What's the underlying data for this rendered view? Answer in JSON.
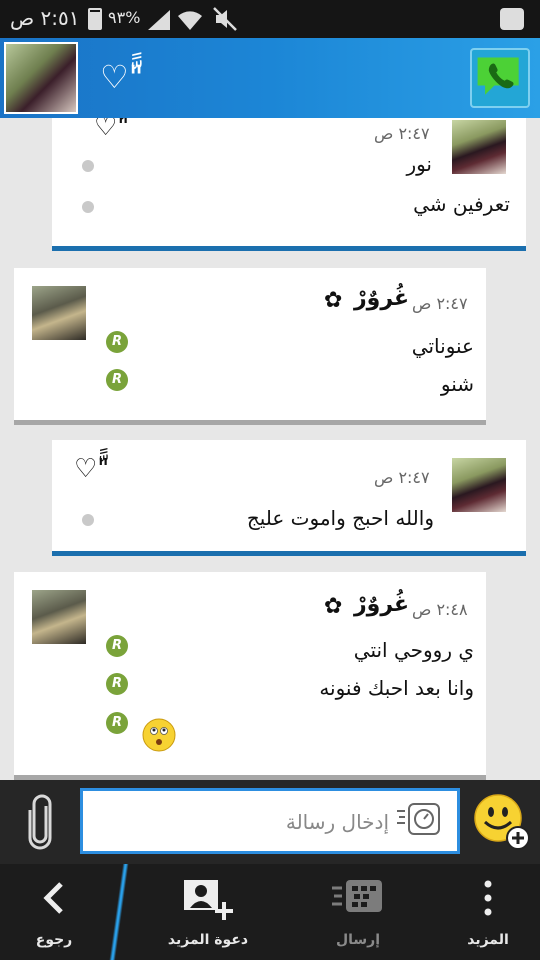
{
  "status": {
    "time": "٢:٥١ ص",
    "battery": "٩٣%"
  },
  "header": {
    "contact_name": "♡\"ًّ"
  },
  "messages": [
    {
      "side": "mine",
      "sender": "♡\"ًّ",
      "time": "٢:٤٧ ص",
      "lines": [
        "نور",
        "تعرفين شي"
      ]
    },
    {
      "side": "theirs",
      "sender": "غُروٌرْ",
      "time": "٢:٤٧ ص",
      "lines": [
        "عنوناتي",
        "شنو"
      ]
    },
    {
      "side": "mine",
      "sender": "♡\"ًّ",
      "time": "٢:٤٧ ص",
      "lines": [
        "والله احبج واموت عليج"
      ]
    },
    {
      "side": "theirs",
      "sender": "غُروٌرْ",
      "time": "٢:٤٨ ص",
      "lines": [
        "ي رووحي انتي",
        "وانا بعد احبك فنونه"
      ]
    }
  ],
  "read_badge": "R",
  "composer": {
    "placeholder": "إدخال رسالة"
  },
  "toolbar": {
    "back": "رجوع",
    "invite": "دعوة المزيد",
    "send": "إرسال",
    "more": "المزيد"
  },
  "colors": {
    "header": "#1c86d6",
    "accent": "#2d8ee0",
    "mine_border": "#1b6fae",
    "read": "#7aa33a"
  }
}
